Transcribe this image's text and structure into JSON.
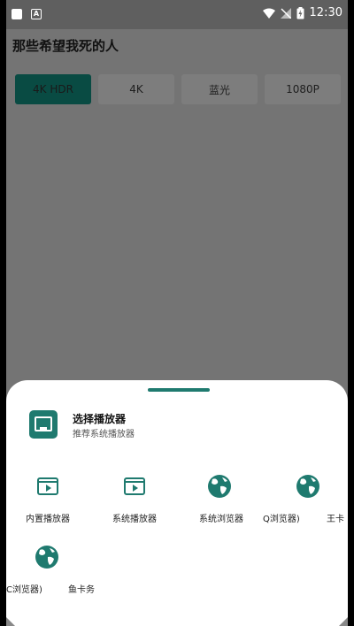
{
  "status_bar": {
    "time": "12:30",
    "notif_letter": "A"
  },
  "app_bar": {
    "title": "那些希望我死的人"
  },
  "quality_tabs": [
    {
      "label": "4K HDR",
      "selected": true
    },
    {
      "label": "4K",
      "selected": false
    },
    {
      "label": "蓝光",
      "selected": false
    },
    {
      "label": "1080P",
      "selected": false
    }
  ],
  "sheet": {
    "header_title": "选择播放器",
    "header_subtitle": "推荐系统播放器",
    "apps": [
      {
        "label": "内置播放器",
        "icon": "player-icon"
      },
      {
        "label": "系统播放器",
        "icon": "player-icon"
      },
      {
        "label": "系统浏览器",
        "icon": "globe-icon"
      },
      {
        "label": "Q浏览器)",
        "icon": "globe-icon"
      },
      {
        "label": "王卡",
        "icon": "globe-icon"
      },
      {
        "label": "C浏览器)",
        "icon": "globe-icon"
      },
      {
        "label": "鱼卡务",
        "icon": "globe-icon"
      }
    ]
  },
  "colors": {
    "accent": "#1f7a6f",
    "selected_tab": "#094b43",
    "overlay": "#747474"
  }
}
